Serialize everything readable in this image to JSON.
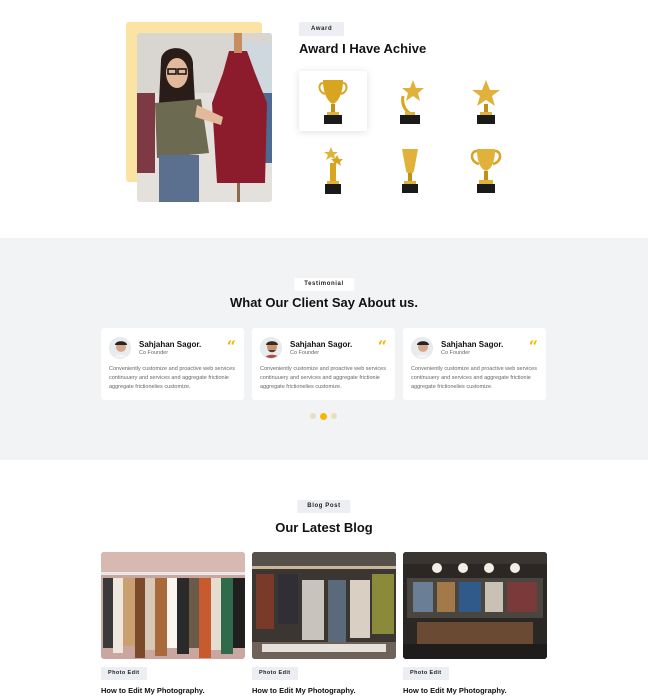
{
  "award": {
    "tag": "Award",
    "title": "Award I Have Achive",
    "trophies": [
      {
        "icon": "cup-trophy-icon",
        "active": true
      },
      {
        "icon": "star-swirl-trophy-icon",
        "active": false
      },
      {
        "icon": "star-trophy-icon",
        "active": false
      },
      {
        "icon": "double-star-trophy-icon",
        "active": false
      },
      {
        "icon": "tall-cup-trophy-icon",
        "active": false
      },
      {
        "icon": "handled-cup-trophy-icon",
        "active": false
      }
    ]
  },
  "testimonial": {
    "tag": "Testimonial",
    "title": "What Our Client Say About us.",
    "cards": [
      {
        "name": "Sahjahan Sagor.",
        "role": "Co Founder",
        "text": "Conveniently customize and proactive web services continuuery and services and aggregate frictionie aggregate frictionelies customize."
      },
      {
        "name": "Sahjahan Sagor.",
        "role": "Co Founder",
        "text": "Conveniently customize and proactive web services continuuery and services and aggregate frictionie aggregate frictionelies customize."
      },
      {
        "name": "Sahjahan Sagor.",
        "role": "Co Founder",
        "text": "Conveniently customize and proactive web services continuuery and services and aggregate frictionie aggregate frictionelies customize."
      }
    ],
    "quote_mark": "“",
    "active_dot": 1
  },
  "blog": {
    "tag": "Blog Post",
    "title": "Our Latest Blog",
    "posts": [
      {
        "category": "Photo Edit",
        "title": "How to Edit My Photography."
      },
      {
        "category": "Photo Edit",
        "title": "How to Edit My Photography."
      },
      {
        "category": "Photo Edit",
        "title": "How to Edit My Photography."
      }
    ]
  },
  "colors": {
    "accent": "#f5b800",
    "award_bg_block": "#fbe3a3",
    "section_gray": "#f2f3f5",
    "tag_bg": "#eceef3"
  }
}
